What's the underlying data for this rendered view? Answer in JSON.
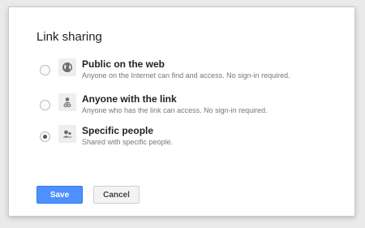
{
  "dialog": {
    "title": "Link sharing",
    "options": [
      {
        "title": "Public on the web",
        "description": "Anyone on the Internet can find and access. No sign-in required.",
        "icon": "globe-icon",
        "selected": false
      },
      {
        "title": "Anyone with the link",
        "description": "Anyone who has the link can access. No sign-in required.",
        "icon": "link-person-icon",
        "selected": false
      },
      {
        "title": "Specific people",
        "description": "Shared with specific people.",
        "icon": "people-icon",
        "selected": true
      }
    ],
    "buttons": {
      "save_label": "Save",
      "cancel_label": "Cancel"
    }
  },
  "colors": {
    "primary_button": "#4d90fe",
    "background": "#eaeaea"
  }
}
